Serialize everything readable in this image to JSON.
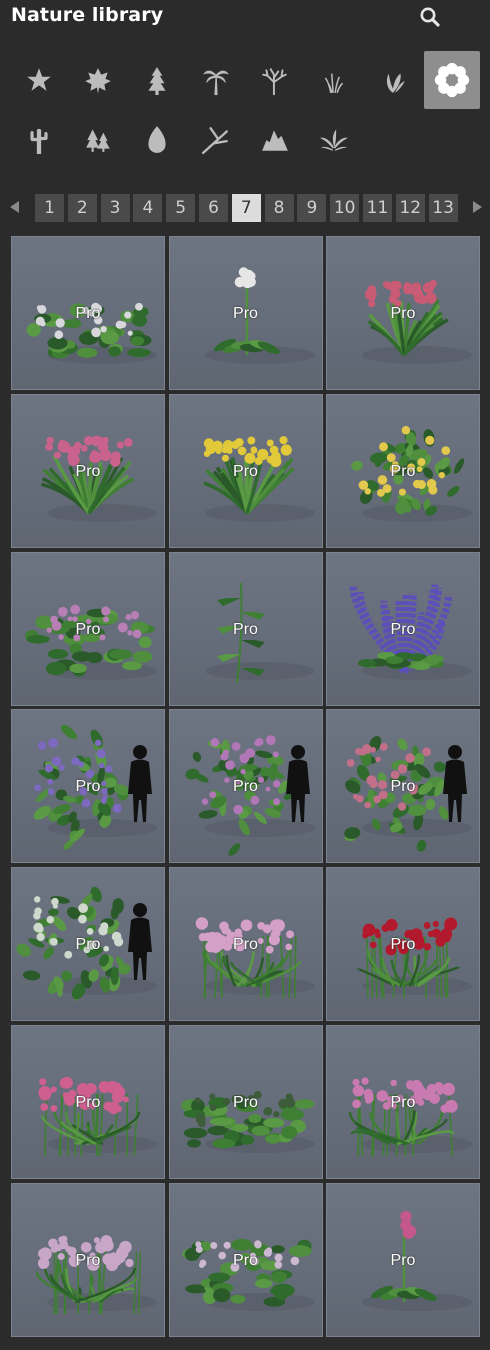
{
  "header": {
    "title": "Nature library"
  },
  "categories": [
    {
      "name": "favorites-icon"
    },
    {
      "name": "leaf-maple-icon"
    },
    {
      "name": "conifer-icon"
    },
    {
      "name": "palm-icon"
    },
    {
      "name": "bare-tree-icon"
    },
    {
      "name": "grass-icon"
    },
    {
      "name": "plant-icon"
    },
    {
      "name": "flower-icon"
    },
    {
      "name": "cactus-icon"
    },
    {
      "name": "forest-icon"
    },
    {
      "name": "single-leaf-icon"
    },
    {
      "name": "branch-icon"
    },
    {
      "name": "rocks-icon"
    },
    {
      "name": "fern-icon"
    }
  ],
  "active_category": 7,
  "pager": {
    "pages": [
      "1",
      "2",
      "3",
      "4",
      "5",
      "6",
      "7",
      "8",
      "9",
      "10",
      "11",
      "12",
      "13"
    ],
    "active_page": "7"
  },
  "tiles": [
    {
      "badge": "Pro",
      "flower": "#d8d8dc",
      "kind": "lowbush",
      "person": false
    },
    {
      "badge": "Pro",
      "flower": "#e6e6e6",
      "kind": "single",
      "person": false
    },
    {
      "badge": "Pro",
      "flower": "#c95b74",
      "kind": "grassy",
      "person": false
    },
    {
      "badge": "Pro",
      "flower": "#c9628c",
      "kind": "grassy",
      "person": false
    },
    {
      "badge": "Pro",
      "flower": "#e1c93a",
      "kind": "grassy",
      "person": false
    },
    {
      "badge": "Pro",
      "flower": "#e2c94d",
      "kind": "bush",
      "person": false
    },
    {
      "badge": "Pro",
      "flower": "#b77fb4",
      "kind": "mound",
      "person": false
    },
    {
      "badge": "Pro",
      "flower": "#6a8a5e",
      "kind": "stalk",
      "person": false
    },
    {
      "badge": "Pro",
      "flower": "#5d4fb8",
      "kind": "spiky",
      "person": false
    },
    {
      "badge": "Pro",
      "flower": "#7d69c0",
      "kind": "bush",
      "person": true
    },
    {
      "badge": "Pro",
      "flower": "#b277b6",
      "kind": "bush",
      "person": true
    },
    {
      "badge": "Pro",
      "flower": "#c2708a",
      "kind": "bush",
      "person": true
    },
    {
      "badge": "Pro",
      "flower": "#cfd8cc",
      "kind": "bush",
      "person": true
    },
    {
      "badge": "Pro",
      "flower": "#d4a0c8",
      "kind": "tall",
      "person": false
    },
    {
      "badge": "Pro",
      "flower": "#b3192d",
      "kind": "tall",
      "person": false
    },
    {
      "badge": "Pro",
      "flower": "#cf5f8e",
      "kind": "tall",
      "person": false
    },
    {
      "badge": "Pro",
      "flower": "#3d5c3a",
      "kind": "lowbush",
      "person": false
    },
    {
      "badge": "Pro",
      "flower": "#c97ab0",
      "kind": "tall",
      "person": false
    },
    {
      "badge": "Pro",
      "flower": "#c7a6c8",
      "kind": "tall",
      "person": false
    },
    {
      "badge": "Pro",
      "flower": "#cdb8d2",
      "kind": "mound",
      "person": false
    },
    {
      "badge": "Pro",
      "flower": "#c4578b",
      "kind": "single",
      "person": false
    }
  ]
}
